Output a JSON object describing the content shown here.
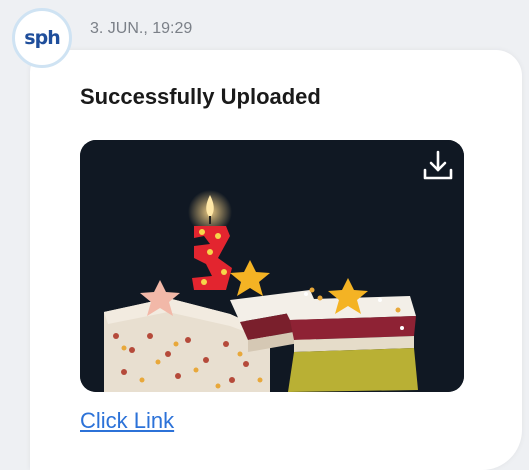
{
  "message": {
    "avatar_text": "sph",
    "timestamp": "3. JUN., 19:29",
    "title": "Successfully Uploaded",
    "image_icon": "download-icon",
    "link_text": "Click Link"
  },
  "colors": {
    "background": "#eef0f3",
    "bubble": "#ffffff",
    "link": "#2c72d8",
    "avatar_ring": "#cfe3f3",
    "avatar_text": "#1f4e9b"
  }
}
